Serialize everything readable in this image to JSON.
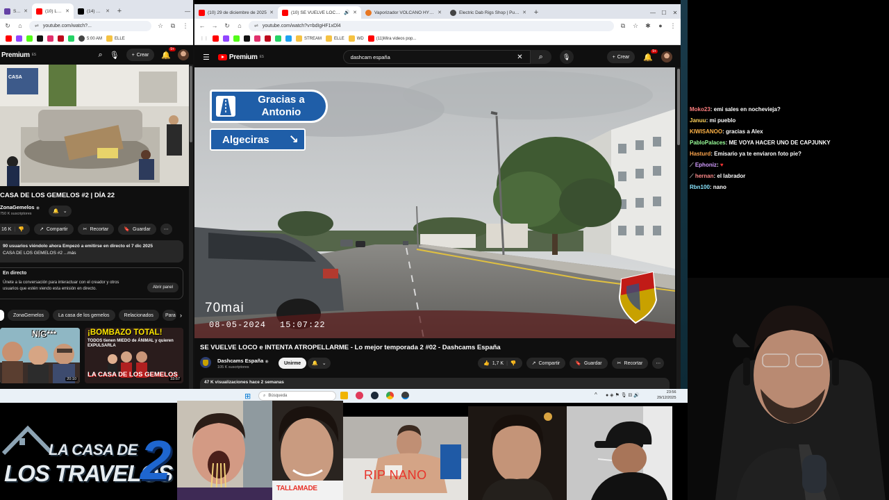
{
  "left_browser": {
    "tabs": [
      {
        "label": "Streams",
        "active": false
      },
      {
        "label": "(10) LA C",
        "active": true
      },
      {
        "label": "(14) ALM",
        "active": false
      }
    ],
    "url": "youtube.com/watch?...",
    "bookmarks": [
      "5:00 AM",
      "ELLE"
    ],
    "yt": {
      "logo": "Premium",
      "create_label": "Crear",
      "notif_count": "9+",
      "video_title": "CASA DE LOS GEMELOS #2 | DÍA 22",
      "channel_name": "ZonaGemelos",
      "subscribers": "750 K suscriptores",
      "likes": "16 K",
      "share_label": "Compartir",
      "clip_label": "Recortar",
      "save_label": "Guardar",
      "description_line1": "90 usuarios viéndolo ahora  Empezó a emitirse en directo el 7 dic 2025",
      "description_line2": "CASA DE LOS GEMELOS #2 ...más",
      "live_chat_title": "En directo",
      "live_chat_text1": "Únete a la conversación para interactuar con el creador y otros",
      "live_chat_text2": "usuarios que estén viendo esta emisión en directo.",
      "open_panel_label": "Abrir panel",
      "chips": [
        "ZonaGemelos",
        "La casa de los gemelos",
        "Relacionados",
        "Para ti"
      ],
      "thumb1": {
        "caption": "NIG***",
        "duration": "20:10"
      },
      "thumb2": {
        "caption_top": "¡BOMBAZO TOTAL!",
        "caption_mid": "TODOS tienen MIEDO de ÁNIMAL y quieren EXPULSARLA",
        "caption_bottom": "LA CASA DE LOS GEMELOS",
        "duration": "33:57"
      }
    }
  },
  "right_browser": {
    "tabs": [
      {
        "label": "(10) 29 de diciembre de 2025",
        "active": false
      },
      {
        "label": "(10) SE VUELVE LOCO e INTE",
        "active": true
      },
      {
        "label": "Vaporizador VOLCANO HYBRI",
        "active": false
      },
      {
        "label": "Electric Dab Rigs Shop | Puffco",
        "active": false
      }
    ],
    "url": "youtube.com/watch?v=bdIgHF1xDl4",
    "bookmarks": [
      "STREAM",
      "ELLE",
      "WD",
      "(11)Mira videos pop..."
    ],
    "yt": {
      "logo": "Premium",
      "search_value": "dashcam españa",
      "create_label": "Crear",
      "notif_count": "9+",
      "video": {
        "sign_top": "Gracias a Antonio",
        "sign_top_line1": "Gracias a",
        "sign_top_line2": "Antonio",
        "sign_bottom": "Algeciras",
        "camera_brand": "70mai",
        "date": "08-05-2024",
        "time": "15:07:22"
      },
      "video_title": "SE VUELVE LOCO e INTENTA ATROPELLARME - Lo mejor temporada 2 #02 - Dashcams España",
      "channel_name": "Dashcams España",
      "subscribers": "105 K suscriptores",
      "join_label": "Unirme",
      "likes": "1,7 K",
      "share_label": "Compartir",
      "save_label": "Guardar",
      "clip_label": "Recortar",
      "views": "47 K visualizaciones  hace 2 semanas"
    }
  },
  "taskbar": {
    "search_placeholder": "Búsqueda",
    "time": "23:56",
    "date": "29/12/2025"
  },
  "chat": {
    "messages": [
      {
        "user": "Moko23",
        "text": ": emi sales en nochevieja?",
        "color": "#ff7f7f"
      },
      {
        "user": "Januu",
        "text": ": mi pueblo",
        "color": "#ffd35c"
      },
      {
        "user": "KIWISANOO",
        "text": ": gracias a Alex",
        "color": "#ffb347"
      },
      {
        "user": "PabloPalaces",
        "text": ": ME VOYA HACER UNO DE CAPJUNKY",
        "color": "#9aff9a"
      },
      {
        "user": "Hasturd",
        "text": ": Emisario ya te enviaron foto pie?",
        "color": "#ffa64d"
      },
      {
        "user": "Ephoniz",
        "text": ":",
        "color": "#d29cff"
      },
      {
        "user": "hernan",
        "text": ": el labrador",
        "color": "#ff8a8a"
      },
      {
        "user": "Rbn100",
        "text": ": nano",
        "color": "#8ae6ff"
      }
    ]
  },
  "overlay": {
    "logo_line1": "LA CASA DE",
    "logo_line2": "LOS TRAVELOS",
    "logo_number": "2",
    "photo2_caption": "TALLAMADE",
    "photo4_caption": "RIP NANO"
  },
  "colors": {
    "yt_bg": "#0f0f0f",
    "yt_red": "#ff0000",
    "sign_blue": "#1f5ea8",
    "chrome_tab_bg": "#dfe3eb"
  }
}
